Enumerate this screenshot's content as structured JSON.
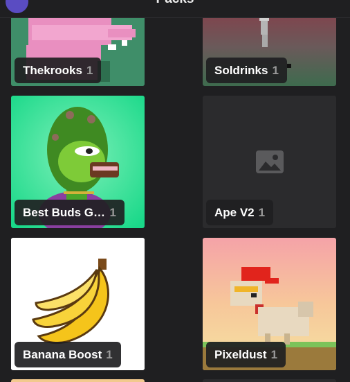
{
  "header": {
    "title": "Packs"
  },
  "cards": [
    {
      "name": "Thekrooks",
      "count": "1"
    },
    {
      "name": "Soldrinks",
      "count": "1"
    },
    {
      "name": "Best Buds Gen...",
      "count": "1"
    },
    {
      "name": "Ape V2",
      "count": "1"
    },
    {
      "name": "Banana Boost",
      "count": "1"
    },
    {
      "name": "Pixeldust",
      "count": "1"
    }
  ],
  "icons": {
    "placeholder": "image-placeholder-icon"
  },
  "colors": {
    "background": "#1f1f21",
    "avatar": "#5a4cc2",
    "label_bg": "#202022",
    "count": "#9a9a9a"
  }
}
